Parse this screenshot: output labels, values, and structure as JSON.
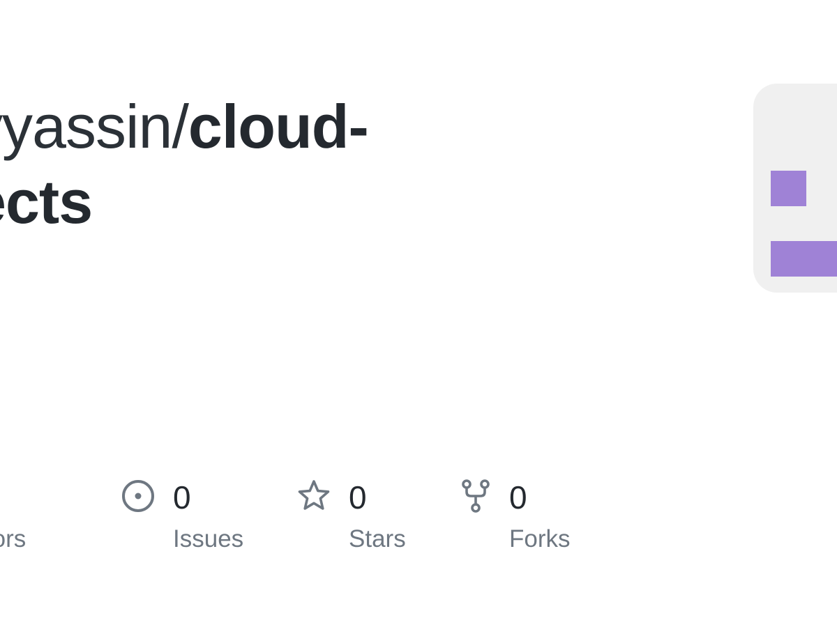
{
  "repo": {
    "owner_visible": "yyassin",
    "separator": "/",
    "name_line1": "cloud-",
    "name_line2": "ects"
  },
  "language_card": {
    "bar_color": "#9f82d6",
    "background": "#f0f0f0"
  },
  "stats": {
    "contributors": {
      "label": "butors",
      "icon": "people-icon"
    },
    "issues": {
      "count": "0",
      "label": "Issues",
      "icon": "issue-opened-icon"
    },
    "stars": {
      "count": "0",
      "label": "Stars",
      "icon": "star-icon"
    },
    "forks": {
      "count": "0",
      "label": "Forks",
      "icon": "repo-forked-icon"
    }
  }
}
